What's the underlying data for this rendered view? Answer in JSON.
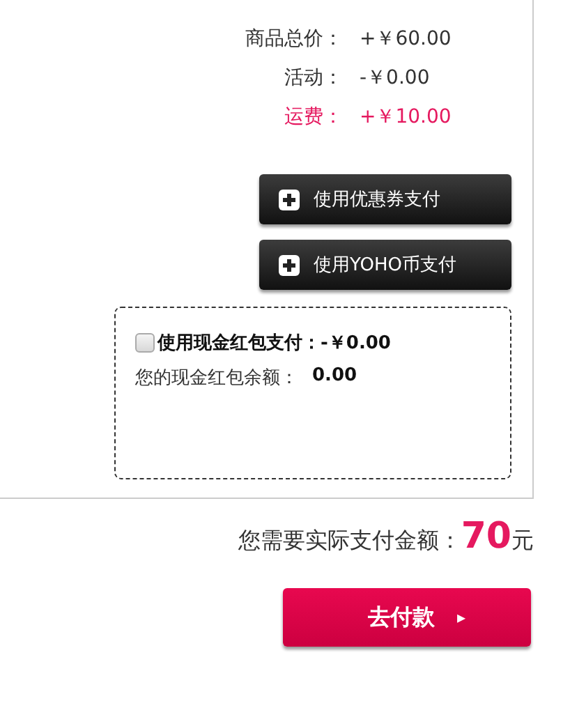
{
  "summary": [
    {
      "label": "商品总价：",
      "value": "+￥60.00",
      "highlight": false
    },
    {
      "label": "活动：",
      "value": "-￥0.00",
      "highlight": false
    },
    {
      "label": "运费：",
      "value": "+￥10.00",
      "highlight": true
    }
  ],
  "pay_options": [
    {
      "label": "使用优惠券支付"
    },
    {
      "label": "使用YOHO币支付"
    }
  ],
  "red_packet": {
    "checked": false,
    "label": "使用现金红包支付：",
    "amount": "-￥0.00",
    "balance_label": "您的现金红包余额：",
    "balance": "0.00"
  },
  "total": {
    "label": "您需要实际支付金额：",
    "amount": "70",
    "unit": "元"
  },
  "pay_button": {
    "label": "去付款",
    "arrow": "▸"
  }
}
